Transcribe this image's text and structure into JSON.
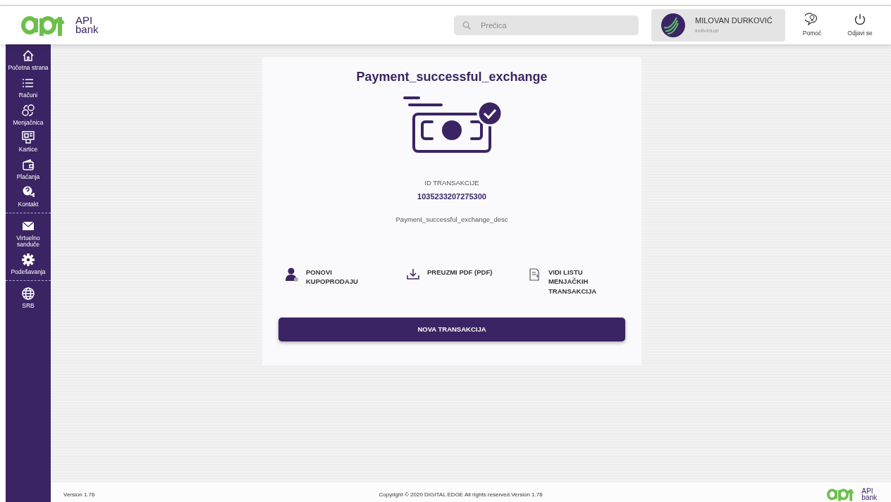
{
  "header": {
    "logo_text": [
      "API",
      "bank"
    ],
    "search": {
      "placeholder": "Prečica"
    },
    "user": {
      "name": "MILOVAN DURKOVIĆ",
      "type": "individual"
    },
    "actions": [
      {
        "kind": "help",
        "label": "Pomoć"
      },
      {
        "kind": "logout",
        "label": "Odjavi se"
      }
    ]
  },
  "sidebar": {
    "groups": [
      [
        {
          "kind": "home",
          "label": "Početna strana"
        },
        {
          "kind": "accounts",
          "label": "Računi"
        },
        {
          "kind": "exchange",
          "label": "Menjačnica"
        },
        {
          "kind": "cards",
          "label": "Kartice"
        },
        {
          "kind": "payments",
          "label": "Plaćanja"
        },
        {
          "kind": "contact",
          "label": "Kontakt"
        }
      ],
      [
        {
          "kind": "inbox",
          "label": "Virtuelno sanduče"
        },
        {
          "kind": "settings",
          "label": "Podešavanja"
        }
      ],
      [
        {
          "kind": "language",
          "label": "SRB"
        }
      ]
    ]
  },
  "result": {
    "title": "Payment_successful_exchange",
    "id_label": "ID TRANSAKCIJE",
    "id_value": "1035233207275300",
    "description": "Payment_successful_exchange_desc",
    "actions": [
      {
        "kind": "repeat",
        "label": "PONOVI KUPOPRODAJU"
      },
      {
        "kind": "download",
        "label": "PREUZMI PDF (PDF)"
      },
      {
        "kind": "list",
        "label": "VIDI LISTU MENJAČKIH TRANSAKCIJA"
      }
    ],
    "primary_button": "NOVA TRANSAKCIJA"
  },
  "footer": {
    "version": "Version 1.76",
    "copyright": "Copyright © 2020 DIGITAL EDGE All rights reserved.Version 1.76",
    "logo_text": [
      "API",
      "bank"
    ]
  }
}
